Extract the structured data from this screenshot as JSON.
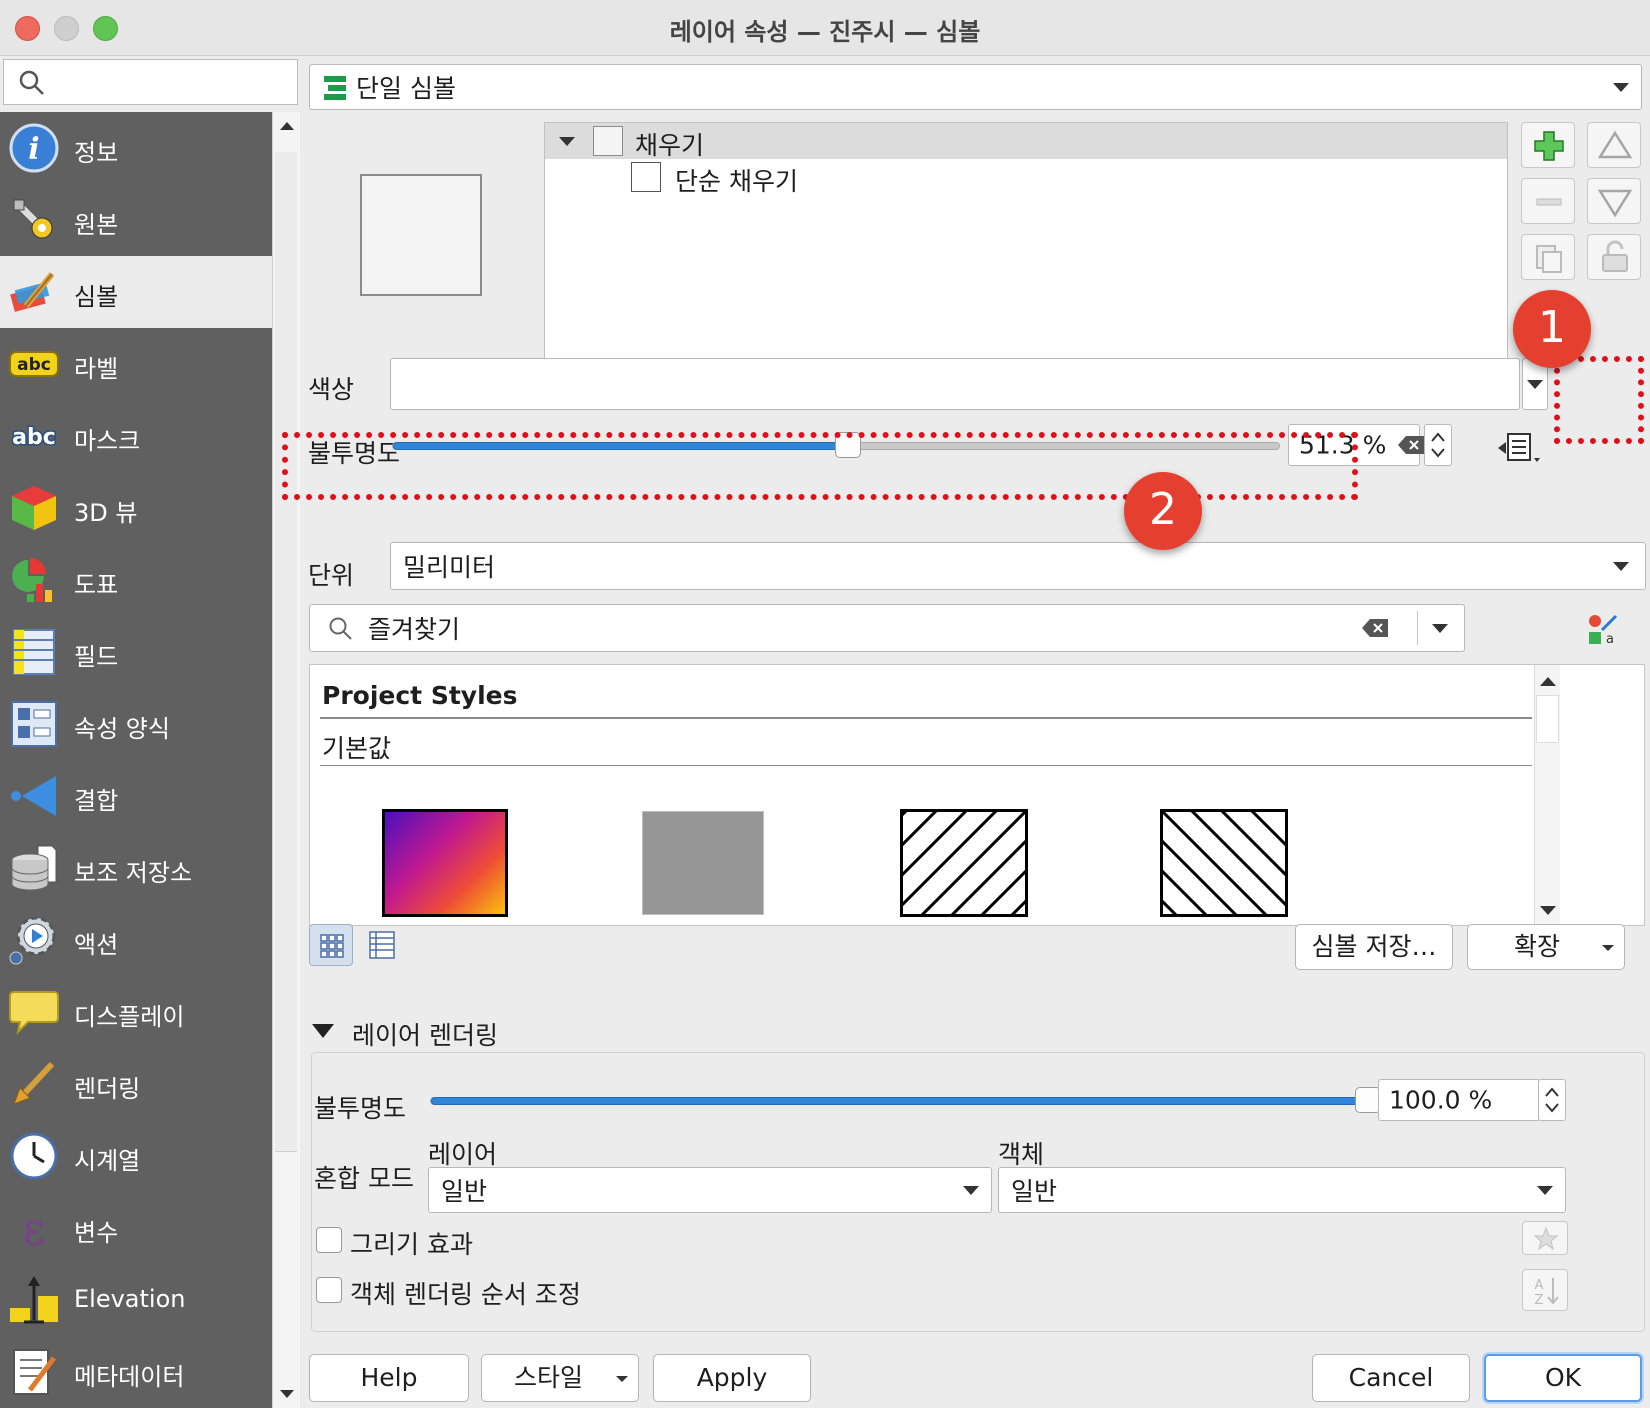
{
  "window": {
    "title": "레이어 속성 — 진주시 — 심볼"
  },
  "sidebar": {
    "items": [
      {
        "label": "정보",
        "icon": "info-icon"
      },
      {
        "label": "원본",
        "icon": "tools-icon"
      },
      {
        "label": "심볼",
        "icon": "paintbrush-icon",
        "selected": true
      },
      {
        "label": "라벨",
        "icon": "abc-label-icon"
      },
      {
        "label": "마스크",
        "icon": "abc-mask-icon"
      },
      {
        "label": "3D 뷰",
        "icon": "cube-3d-icon"
      },
      {
        "label": "도표",
        "icon": "diagram-icon"
      },
      {
        "label": "필드",
        "icon": "fields-table-icon"
      },
      {
        "label": "속성 양식",
        "icon": "form-icon"
      },
      {
        "label": "결합",
        "icon": "join-icon"
      },
      {
        "label": "보조 저장소",
        "icon": "database-icon"
      },
      {
        "label": "액션",
        "icon": "action-gear-icon"
      },
      {
        "label": "디스플레이",
        "icon": "speech-bubble-icon"
      },
      {
        "label": "렌더링",
        "icon": "brush-icon"
      },
      {
        "label": "시계열",
        "icon": "clock-icon"
      },
      {
        "label": "변수",
        "icon": "epsilon-icon"
      },
      {
        "label": "Elevation",
        "icon": "elevation-icon"
      },
      {
        "label": "메타데이터",
        "icon": "metadata-icon"
      }
    ]
  },
  "renderer": {
    "type_label": "단일 심볼"
  },
  "symbol_tree": {
    "root_label": "채우기",
    "child_label": "단순 채우기"
  },
  "color": {
    "label": "색상"
  },
  "opacity": {
    "label": "불투명도",
    "value_text": "51.3 %",
    "value": 51.3
  },
  "unit": {
    "label": "단위",
    "value": "밀리미터"
  },
  "favorites": {
    "search_text": "즐겨찾기"
  },
  "styles": {
    "group_title": "Project Styles",
    "subgroup": "기본값"
  },
  "buttons": {
    "save_symbol": "심볼 저장…",
    "advanced": "확장"
  },
  "layer_rendering": {
    "title": "레이어 렌더링",
    "opacity_label": "불투명도",
    "opacity_text": "100.0 %",
    "opacity_value": 100,
    "blend_label": "혼합 모드",
    "layer_label": "레이어",
    "layer_value": "일반",
    "feature_label": "객체",
    "feature_value": "일반",
    "draw_effects": "그리기 효과",
    "feature_order": "객체 렌더링 순서 조정"
  },
  "footer": {
    "help": "Help",
    "style": "스타일",
    "apply": "Apply",
    "cancel": "Cancel",
    "ok": "OK"
  },
  "annotations": {
    "badge1": "1",
    "badge2": "2"
  }
}
